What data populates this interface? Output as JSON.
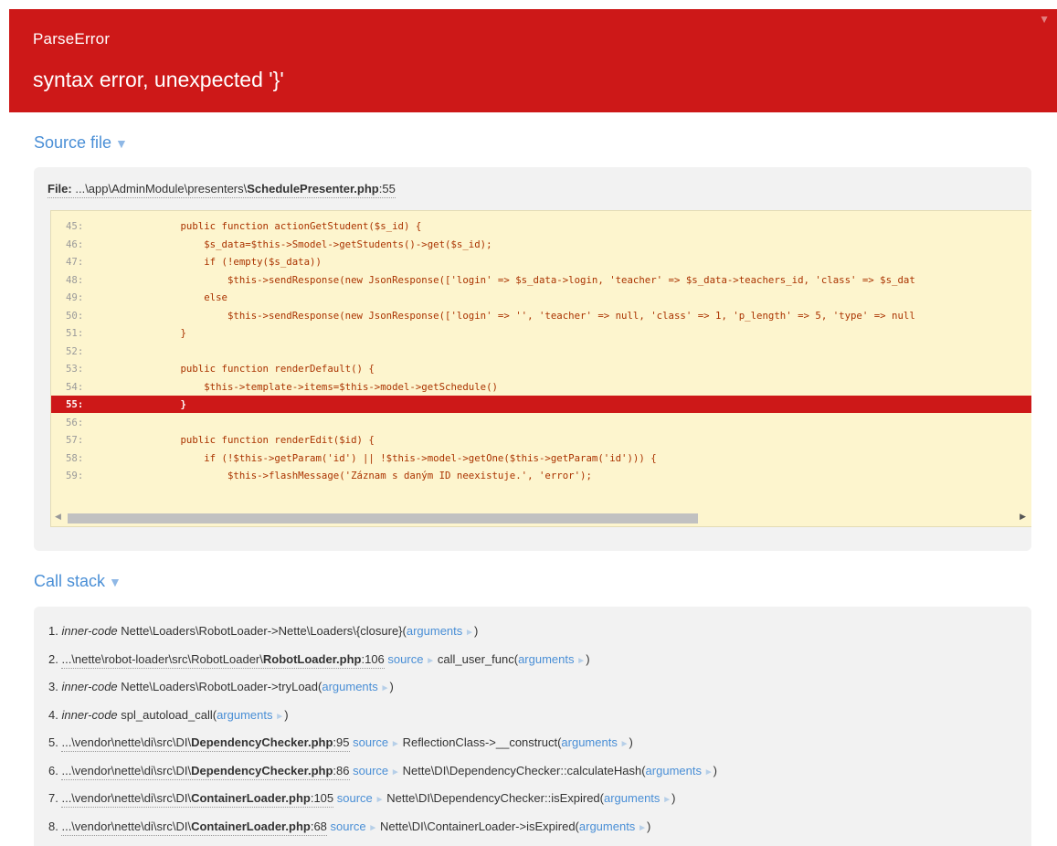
{
  "error": {
    "type": "ParseError",
    "message": "syntax error, unexpected '}'",
    "toggle": "▼"
  },
  "source_section": {
    "title": "Source file",
    "arrow": "▼"
  },
  "file": {
    "label": "File:",
    "dir": "...\\app\\AdminModule\\presenters\\",
    "name": "SchedulePresenter.php",
    "line": ":55"
  },
  "code_lines": [
    {
      "num": "45:",
      "code": "        public function actionGetStudent($s_id) {"
    },
    {
      "num": "46:",
      "code": "            $s_data=$this->Smodel->getStudents()->get($s_id);"
    },
    {
      "num": "47:",
      "code": "            if (!empty($s_data))"
    },
    {
      "num": "48:",
      "code": "                $this->sendResponse(new JsonResponse(['login' => $s_data->login, 'teacher' => $s_data->teachers_id, 'class' => $s_dat"
    },
    {
      "num": "49:",
      "code": "            else"
    },
    {
      "num": "50:",
      "code": "                $this->sendResponse(new JsonResponse(['login' => '', 'teacher' => null, 'class' => 1, 'p_length' => 5, 'type' => null"
    },
    {
      "num": "51:",
      "code": "        }"
    },
    {
      "num": "52:",
      "code": ""
    },
    {
      "num": "53:",
      "code": "        public function renderDefault() {"
    },
    {
      "num": "54:",
      "code": "            $this->template->items=$this->model->getSchedule()"
    },
    {
      "num": "55:",
      "code": "        }",
      "highlight": true
    },
    {
      "num": "56:",
      "code": ""
    },
    {
      "num": "57:",
      "code": "        public function renderEdit($id) {"
    },
    {
      "num": "58:",
      "code": "            if (!$this->getParam('id') || !$this->model->getOne($this->getParam('id'))) {"
    },
    {
      "num": "59:",
      "code": "                $this->flashMessage('Záznam s daným ID neexistuje.', 'error');"
    }
  ],
  "stack_section": {
    "title": "Call stack",
    "arrow": "▼"
  },
  "stack": [
    {
      "n": "1.",
      "inner": "inner-code",
      "dir": "",
      "file": "",
      "line": "",
      "source": "",
      "call": " Nette\\Loaders\\RobotLoader->Nette\\Loaders\\{closure}(",
      "args": "arguments",
      "close": ")"
    },
    {
      "n": "2.",
      "inner": "",
      "dir": "...\\nette\\robot-loader\\src\\RobotLoader\\",
      "file": "RobotLoader.php",
      "line": ":106",
      "source": "source",
      "call": "call_user_func(",
      "args": "arguments",
      "close": ")"
    },
    {
      "n": "3.",
      "inner": "inner-code",
      "dir": "",
      "file": "",
      "line": "",
      "source": "",
      "call": " Nette\\Loaders\\RobotLoader->tryLoad(",
      "args": "arguments",
      "close": ")"
    },
    {
      "n": "4.",
      "inner": "inner-code",
      "dir": "",
      "file": "",
      "line": "",
      "source": "",
      "call": " spl_autoload_call(",
      "args": "arguments",
      "close": ")"
    },
    {
      "n": "5.",
      "inner": "",
      "dir": "...\\vendor\\nette\\di\\src\\DI\\",
      "file": "DependencyChecker.php",
      "line": ":95",
      "source": "source",
      "call": "ReflectionClass->__construct(",
      "args": "arguments",
      "close": ")"
    },
    {
      "n": "6.",
      "inner": "",
      "dir": "...\\vendor\\nette\\di\\src\\DI\\",
      "file": "DependencyChecker.php",
      "line": ":86",
      "source": "source",
      "call": "Nette\\DI\\DependencyChecker::calculateHash(",
      "args": "arguments",
      "close": ")"
    },
    {
      "n": "7.",
      "inner": "",
      "dir": "...\\vendor\\nette\\di\\src\\DI\\",
      "file": "ContainerLoader.php",
      "line": ":105",
      "source": "source",
      "call": "Nette\\DI\\DependencyChecker::isExpired(",
      "args": "arguments",
      "close": ")"
    },
    {
      "n": "8.",
      "inner": "",
      "dir": "...\\vendor\\nette\\di\\src\\DI\\",
      "file": "ContainerLoader.php",
      "line": ":68",
      "source": "source",
      "call": "Nette\\DI\\ContainerLoader->isExpired(",
      "args": "arguments",
      "close": ")"
    }
  ],
  "colors": {
    "header_bg": "#cd1818",
    "link": "#4a8fd6",
    "code_bg": "#fdf5ce",
    "code_text": "#a30"
  }
}
